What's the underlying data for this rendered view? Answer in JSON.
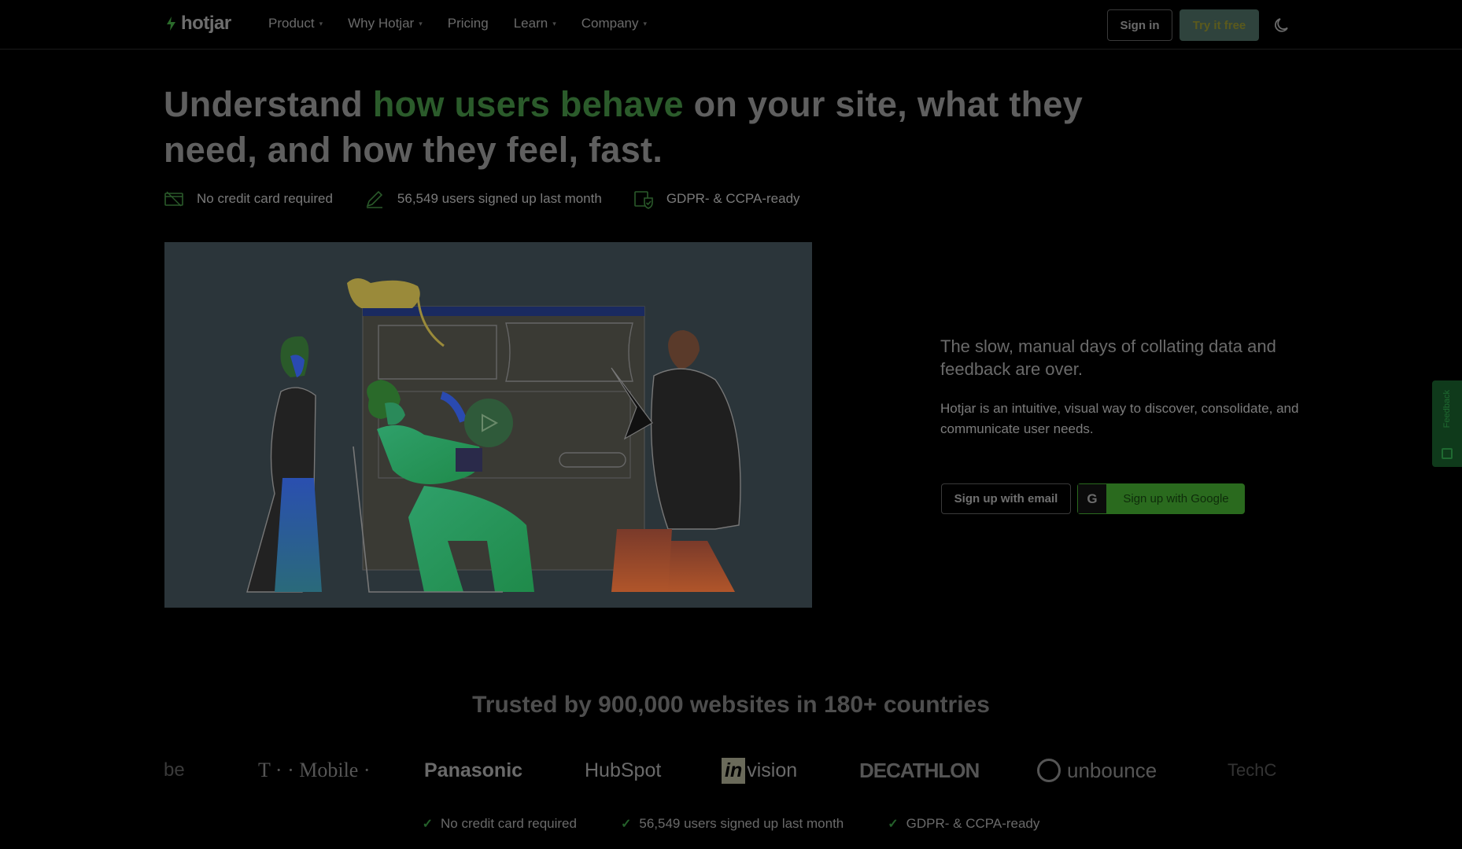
{
  "nav": {
    "logo_text": "hotjar",
    "items": [
      {
        "label": "Product",
        "has_caret": true
      },
      {
        "label": "Why Hotjar",
        "has_caret": true
      },
      {
        "label": "Pricing",
        "has_caret": false
      },
      {
        "label": "Learn",
        "has_caret": true
      },
      {
        "label": "Company",
        "has_caret": true
      }
    ],
    "signin_label": "Sign in",
    "try_label": "Try it free"
  },
  "hero": {
    "headline_pre": "Understand ",
    "headline_accent": "how users behave",
    "headline_post": " on your site, what they need, and how they feel, fast.",
    "badges": [
      {
        "icon": "credit-card-icon",
        "text": "No credit card required"
      },
      {
        "icon": "pencil-icon",
        "text": "56,549 users signed up last month"
      },
      {
        "icon": "shield-check-icon",
        "text": "GDPR- & CCPA-ready"
      }
    ]
  },
  "aside": {
    "subhead": "The slow, manual days of collating data and feedback are over.",
    "description": "Hotjar is an intuitive, visual way to discover, consolidate, and communicate user needs.",
    "email_button": "Sign up with email",
    "google_button": "Sign up with Google",
    "google_glyph": "G"
  },
  "feedback_tab": {
    "label": "Feedback"
  },
  "trusted": {
    "title": "Trusted by 900,000 websites in 180+ countries",
    "logos": [
      "be",
      "T · · Mobile ·",
      "Panasonic",
      "HubSpot",
      "invision",
      "DECATHLON",
      "unbounce",
      "TechC"
    ]
  },
  "footer_checks": [
    "No credit card required",
    "56,549 users signed up last month",
    "GDPR- & CCPA-ready"
  ],
  "colors": {
    "accent_green": "#2b5b2b",
    "google_button": "#2a6a1e",
    "illustration_bg": "#2b353a"
  }
}
